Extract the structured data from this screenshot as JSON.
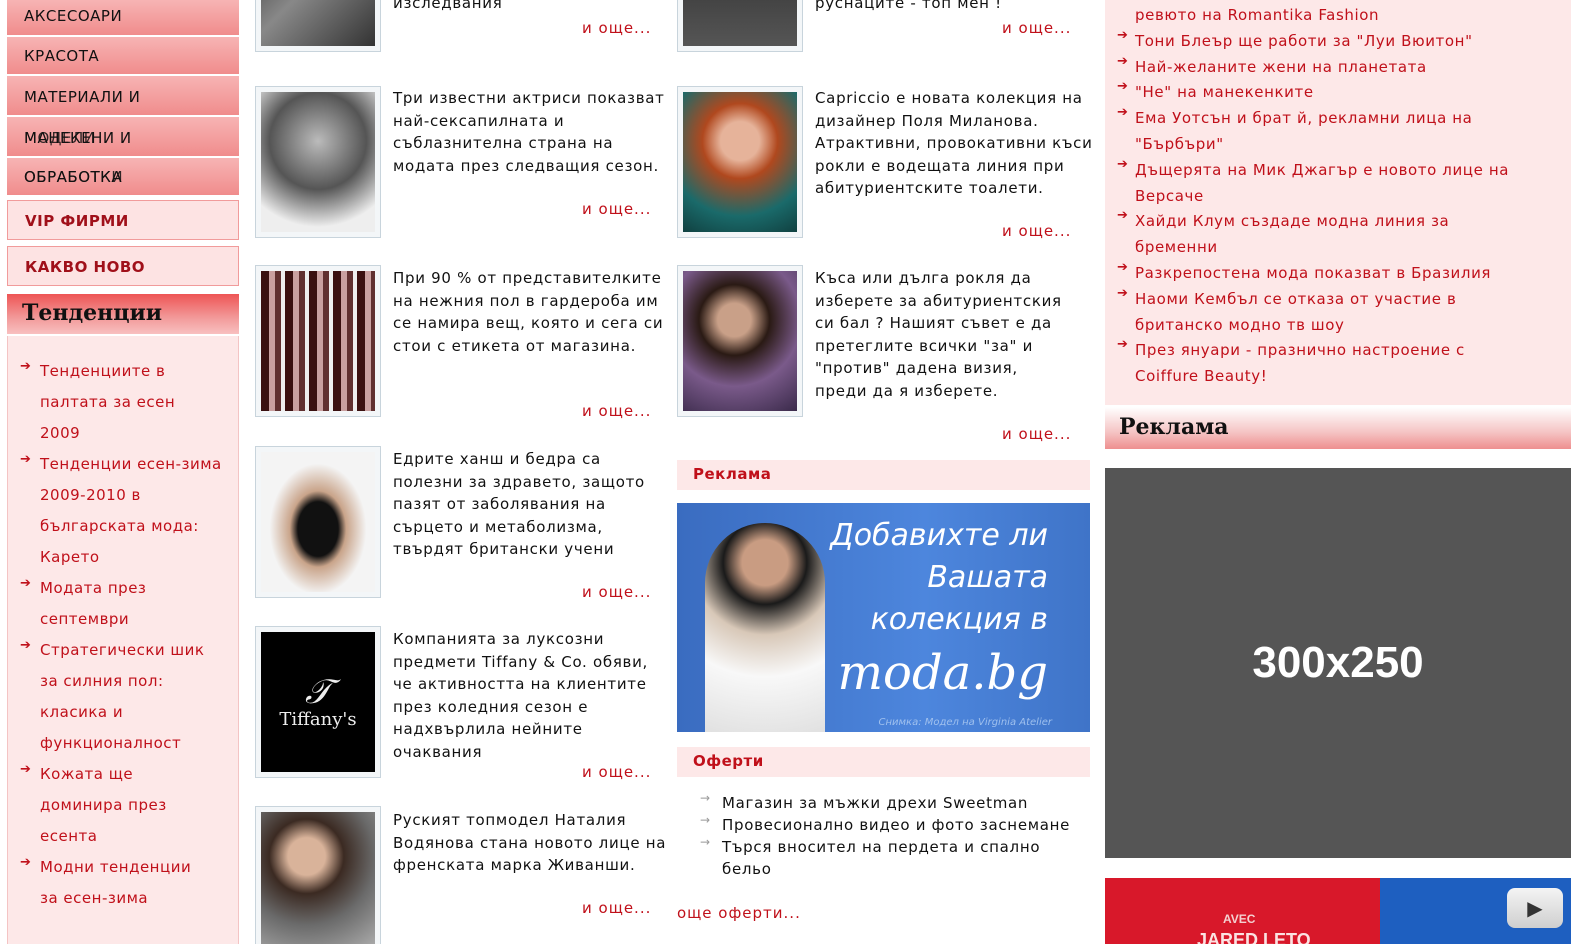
{
  "nav": {
    "items": [
      "Аксесоари",
      "Красота",
      "Материали и",
      "Манекени и",
      "Обработка"
    ],
    "overlap_text": [
      "модели",
      "обработки"
    ],
    "vip": "VIP фирми",
    "news": "Какво ново"
  },
  "trends": {
    "title": "Тенденции",
    "items": [
      "Тенденциите в палтата за есен 2009",
      "Тенденции есен-зима 2009-2010 в българската мода: Карето",
      "Модата през септември",
      "Стратегически шик за силния пол: класика и функционалност",
      "Кожата ще доминира през есента",
      "Модни тенденции за есен-зима"
    ]
  },
  "articles_left": [
    {
      "text": "изследвания",
      "more": "и още..."
    },
    {
      "text": "Три известни актриси показват най-сексапилната и съблазнителна страна на модата през следващия сезон.",
      "more": "и още..."
    },
    {
      "text": "При 90 % от представителките на нежния пол в гардероба им се намира вещ, която и сега си стои с етикета от магазина.",
      "more": "и още..."
    },
    {
      "text": "Едрите ханш и бедра са полезни за здравето, защото пазят от заболявания на сърцето и метаболизма, твърдят британски учени",
      "more": "и още..."
    },
    {
      "text": "Компанията за луксозни предмети Tiffany & Co. обяви, че активността на клиентите през коледния сезон е надхвърлила нейните очаквания",
      "more": "и още..."
    },
    {
      "text": "Руският топмодел Наталия Водянова стана новото лице на френската марка Живанши.",
      "more": "и още..."
    }
  ],
  "articles_right": [
    {
      "text": "руснаците - топ мен !",
      "more": "и още..."
    },
    {
      "text": "Capriccio е новата колекция на дизайнер Поля Миланова. Атрактивни, провокативни къси рокли е водещата линия при абитуриентските тоалети.",
      "more": "и още..."
    },
    {
      "text": "Къса или дълга рокля да изберете за абитуриентския си бал ? Нашият съвет е да претеглите всички \"за\" и \"против\" дадена визия, преди да я изберете.",
      "more": "и още..."
    }
  ],
  "tiffany_logo": "Tiffany's",
  "promo": {
    "ad_label": "Реклама",
    "banner_lines": [
      "Добавихте ли",
      "Вашата",
      "колекция в",
      "moda.bg"
    ],
    "banner_caption": "Снимка: Модел на Virginia Atelier",
    "offers_label": "Оферти",
    "offers": [
      "Магазин за мъжки дрехи Sweetman",
      "Провесионално видео и фото заснемане",
      "Търся вносител на пердета и спално бельо"
    ],
    "more_offers": "още оферти..."
  },
  "right_news": [
    "ревюто на Romantika Fashion",
    "Тони Блеър ще работи за \"Луи Вюитон\"",
    "Най-желаните жени на планетата",
    "\"Не\" на манекенките",
    "Ема Уотсън и брат й, рекламни лица на \"Бърбъри\"",
    "Дъщерята на Мик Джагър е новото лице на Версаче",
    "Хайди Клум създаде модна линия за бременни",
    "Разкрепостена мода показват в Бразилия",
    "Наоми Кембъл се отказа от участие в британско модно тв шоу",
    "През януари - празнично настроение с Coiffure Beauty!"
  ],
  "right_ad": {
    "label": "Реклама",
    "size_text": "300x250",
    "video_text": "AVEC",
    "video_text2": "JARED LETO"
  },
  "colors": {
    "accent": "#c0101a",
    "pink_bg": "#fde8e8",
    "nav_pink": "#f08c8c"
  }
}
